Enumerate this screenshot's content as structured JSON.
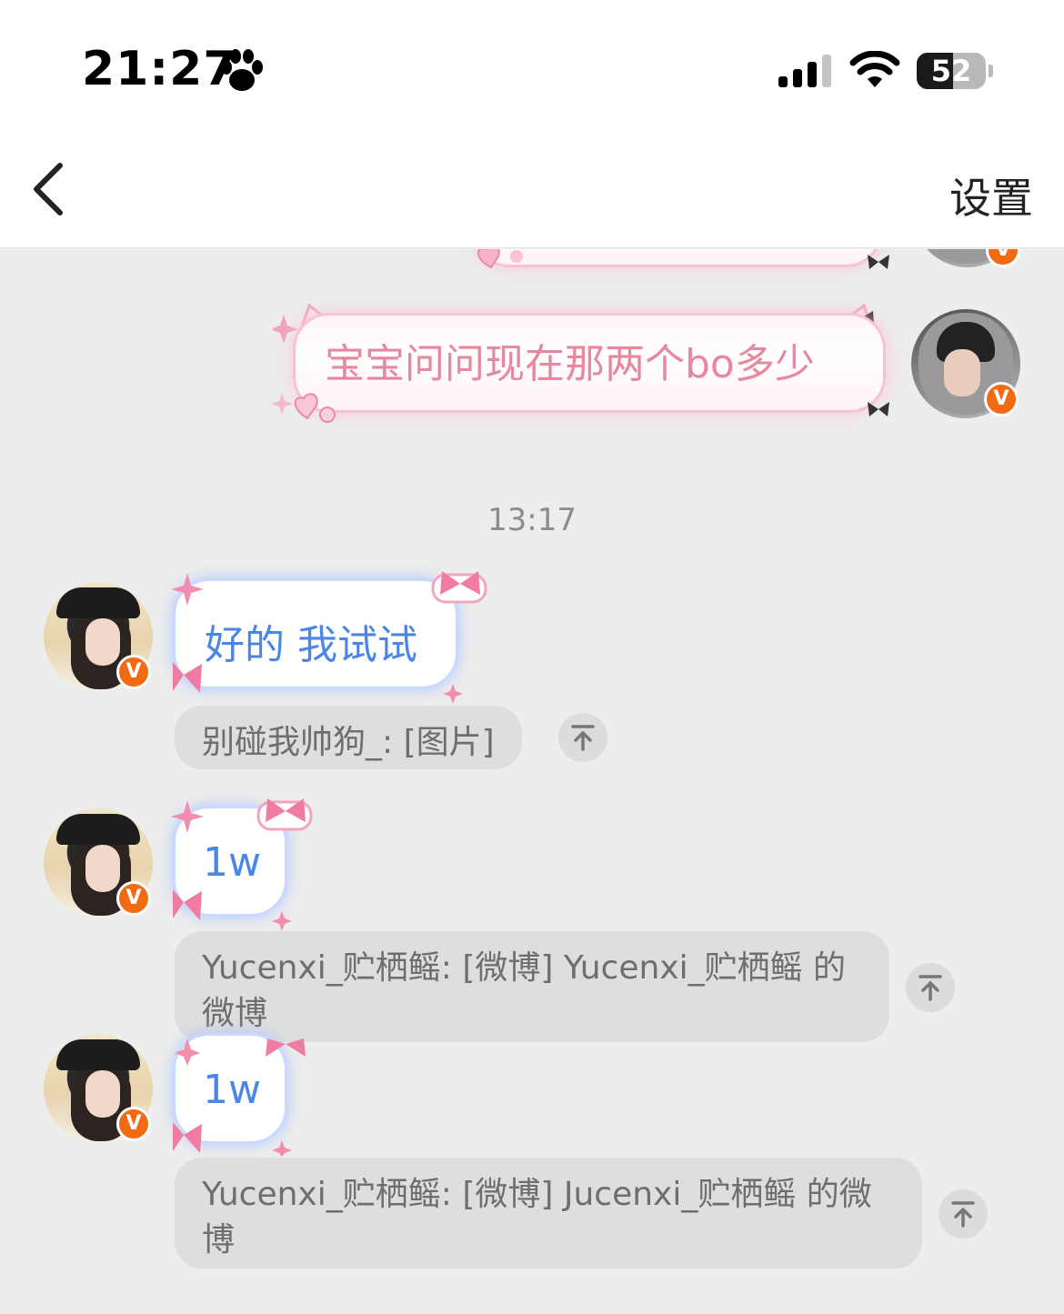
{
  "status_bar": {
    "time": "21:27",
    "battery_level": "52",
    "battery_fraction": 0.52,
    "icons": [
      "paw-icon",
      "signal-icon",
      "wifi-icon",
      "battery-icon"
    ]
  },
  "nav": {
    "title": "",
    "settings_label": "设置",
    "back_icon": "chevron-left-icon"
  },
  "colors": {
    "sent_text": "#e6889f",
    "received_text": "#4a86e8",
    "badge": "#f26b12",
    "background": "#ededed"
  },
  "chat": {
    "sent_message": "宝宝问问现在那两个bo多少",
    "timestamp_1": "13:17",
    "messages": [
      {
        "text": "好的 我试试",
        "quote": "别碰我帅狗_: [图片]"
      },
      {
        "text": "1w",
        "quote": "Yucenxi_贮栖鳐: [微博] Yucenxi_贮栖鳐 的微博"
      },
      {
        "text": "1w",
        "quote": "Yucenxi_贮栖鳐: [微博] Jucenxi_贮栖鳐 的微博"
      }
    ],
    "badge_letter": "V"
  }
}
